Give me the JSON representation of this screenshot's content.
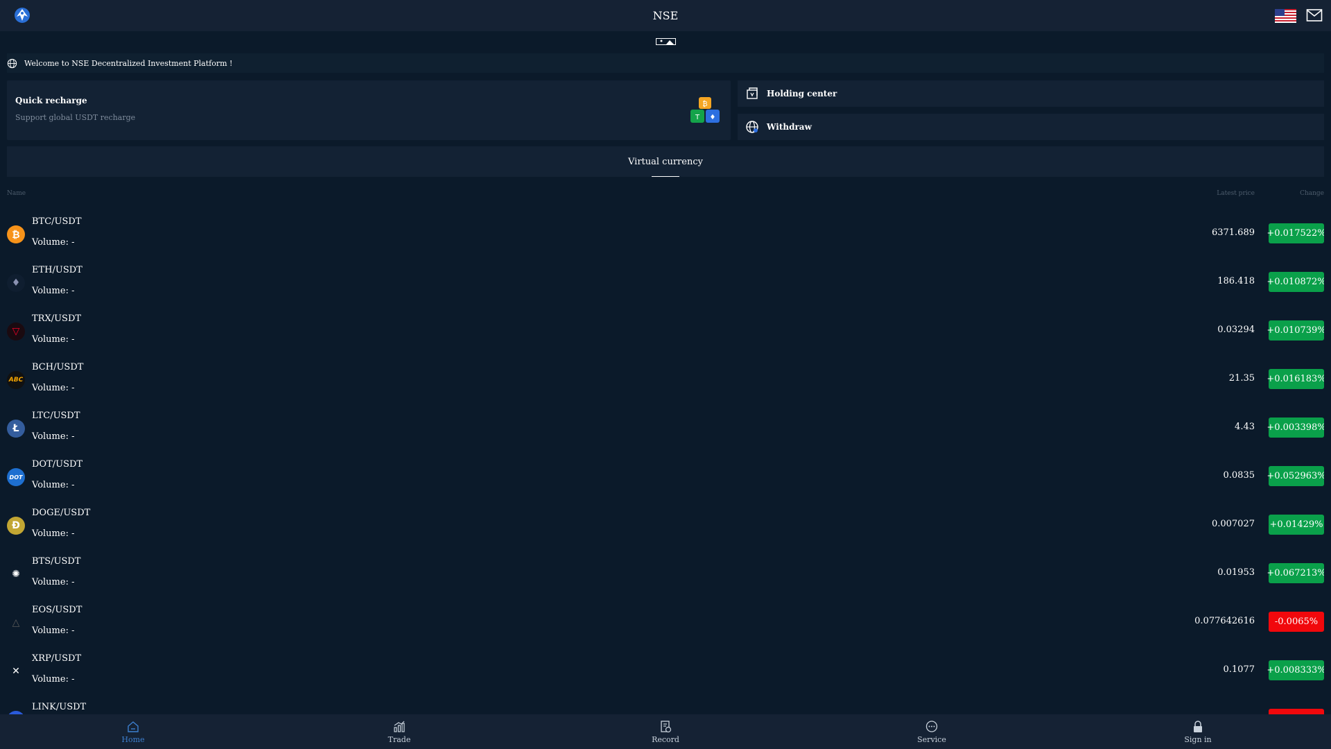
{
  "header": {
    "title": "NSE",
    "logo_icon": "bird-logo-icon",
    "flag_icon": "us-flag-icon",
    "mail_icon": "mail-icon"
  },
  "notice": {
    "text": "Welcome to NSE Decentralized Investment Platform !"
  },
  "recharge": {
    "title": "Quick recharge",
    "subtitle": "Support global USDT recharge"
  },
  "holding": {
    "label": "Holding center"
  },
  "withdraw": {
    "label": "Withdraw"
  },
  "tabs": {
    "active": "Virtual currency"
  },
  "list_header": {
    "name": "Name",
    "price": "Latest price",
    "change": "Change"
  },
  "colors": {
    "up": "#0aa04a",
    "down": "#f1080c",
    "accent": "#3d7fcf",
    "background": "#0b1a2a",
    "panel": "#132234"
  },
  "rows": [
    {
      "pair": "BTC/USDT",
      "volume": "Volume: -",
      "price": "6371.689",
      "change": "+0.017522%",
      "direction": "up",
      "icon": "bitcoin-icon"
    },
    {
      "pair": "ETH/USDT",
      "volume": "Volume: -",
      "price": "186.418",
      "change": "+0.010872%",
      "direction": "up",
      "icon": "ethereum-icon"
    },
    {
      "pair": "TRX/USDT",
      "volume": "Volume: -",
      "price": "0.03294",
      "change": "+0.010739%",
      "direction": "up",
      "icon": "tron-icon"
    },
    {
      "pair": "BCH/USDT",
      "volume": "Volume: -",
      "price": "21.35",
      "change": "+0.016183%",
      "direction": "up",
      "icon": "bitcoin-cash-icon"
    },
    {
      "pair": "LTC/USDT",
      "volume": "Volume: -",
      "price": "4.43",
      "change": "+0.003398%",
      "direction": "up",
      "icon": "litecoin-icon"
    },
    {
      "pair": "DOT/USDT",
      "volume": "Volume: -",
      "price": "0.0835",
      "change": "+0.052963%",
      "direction": "up",
      "icon": "polkadot-icon"
    },
    {
      "pair": "DOGE/USDT",
      "volume": "Volume: -",
      "price": "0.007027",
      "change": "+0.01429%",
      "direction": "up",
      "icon": "dogecoin-icon"
    },
    {
      "pair": "BTS/USDT",
      "volume": "Volume: -",
      "price": "0.01953",
      "change": "+0.067213%",
      "direction": "up",
      "icon": "bitshares-icon"
    },
    {
      "pair": "EOS/USDT",
      "volume": "Volume: -",
      "price": "0.077642616",
      "change": "-0.0065%",
      "direction": "down",
      "icon": "eos-icon"
    },
    {
      "pair": "XRP/USDT",
      "volume": "Volume: -",
      "price": "0.1077",
      "change": "+0.008333%",
      "direction": "up",
      "icon": "xrp-icon"
    },
    {
      "pair": "LINK/USDT",
      "volume": "",
      "price": "",
      "change": "",
      "direction": "down",
      "icon": "chainlink-icon"
    }
  ],
  "nav": [
    {
      "label": "Home",
      "icon": "home-icon",
      "active": true
    },
    {
      "label": "Trade",
      "icon": "chart-icon",
      "active": false
    },
    {
      "label": "Record",
      "icon": "record-icon",
      "active": false
    },
    {
      "label": "Service",
      "icon": "chat-icon",
      "active": false
    },
    {
      "label": "Sign in",
      "icon": "lock-icon",
      "active": false
    }
  ]
}
